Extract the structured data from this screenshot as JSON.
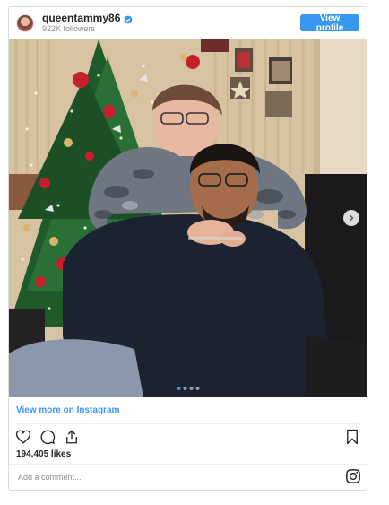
{
  "header": {
    "username": "queentammy86",
    "followers": "922K followers",
    "view_profile_label": "View profile"
  },
  "photo": {
    "alt": "",
    "carousel_dots": 4,
    "active_dot": 0
  },
  "view_more_label": "View more on Instagram",
  "likes_text": "194,405 likes",
  "comment": {
    "placeholder": "Add a comment..."
  },
  "colors": {
    "accent": "#3897f0",
    "text": "#262626",
    "muted": "#8e8e8e",
    "border": "#dbdbdb"
  },
  "icons": [
    "verified-badge-icon",
    "heart-icon",
    "comment-icon",
    "share-icon",
    "bookmark-icon",
    "instagram-logo-icon",
    "chevron-right-icon"
  ]
}
